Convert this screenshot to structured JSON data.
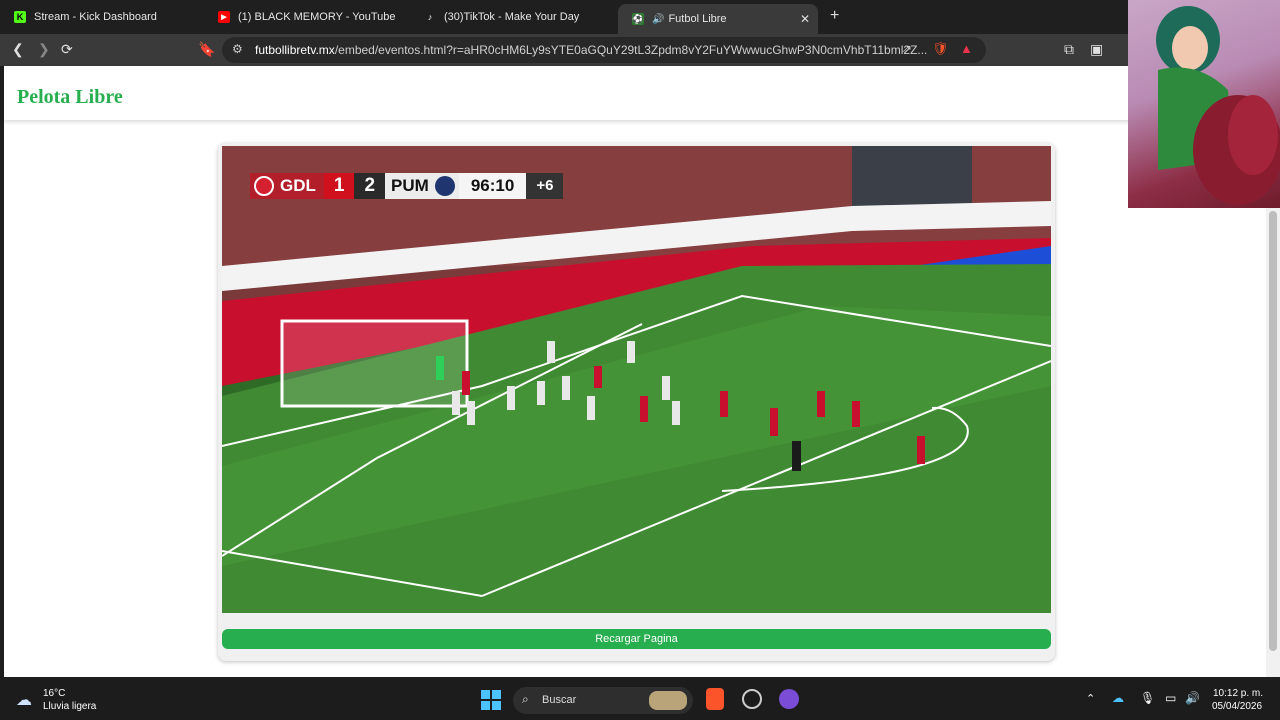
{
  "browser": {
    "tabs": [
      {
        "title": "Stream - Kick Dashboard",
        "icon": "kick-icon",
        "color": "#53fc18"
      },
      {
        "title": "(1) BLACK MEMORY - YouTube",
        "icon": "youtube-icon",
        "color": "#ff0000"
      },
      {
        "title": "(30)TikTok - Make Your Day",
        "icon": "tiktok-icon",
        "color": "#ffffff"
      },
      {
        "title": "Futbol Libre",
        "icon": "soccer-icon",
        "active": true
      }
    ],
    "url_domain": "futbollibretv.mx",
    "url_path": "/embed/eventos.html?r=aHR0cHM6Ly9sYTE0aGQuY29tL3Zpdm8vY2FuYWwwucGhwP3N0cmVhbT11bml2Z..."
  },
  "page": {
    "site_title": "Pelota Libre",
    "reload_button": "Recargar Pagina",
    "brand_color": "#27ae4f"
  },
  "scoreboard": {
    "home": "GDL",
    "home_score": "1",
    "away_score": "2",
    "away": "PUM",
    "clock": "96:10",
    "added_time": "+6"
  },
  "taskbar": {
    "weather_temp": "16°C",
    "weather_desc": "Lluvia ligera",
    "search_placeholder": "Buscar",
    "time": "10:12 p. m.",
    "date": "05/04/2026"
  }
}
